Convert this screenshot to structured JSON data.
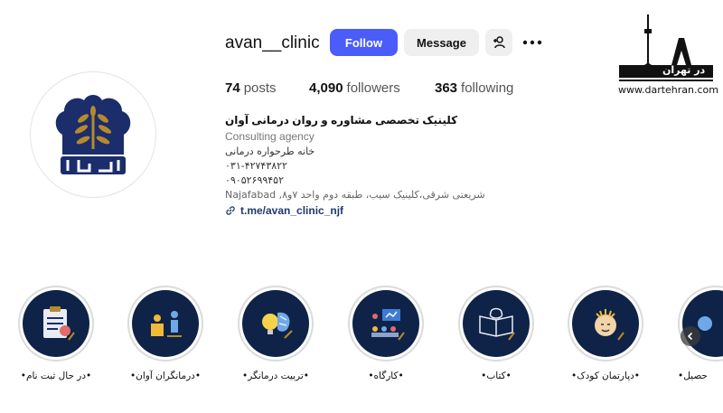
{
  "profile": {
    "username": "avan__clinic",
    "buttons": {
      "follow": "Follow",
      "message": "Message"
    },
    "stats": {
      "posts_count": "74",
      "posts_label": "posts",
      "followers_count": "4,090",
      "followers_label": "followers",
      "following_count": "363",
      "following_label": "following"
    },
    "bio": {
      "name": "کلینیک تخصصی مشاوره و روان درمانی آوان",
      "category": "Consulting agency",
      "line1": "خانه طرحواره درمانی",
      "phone1": "۰۳۱-۴۲۷۴۳۸۲۲",
      "phone2": "۰۹۰۵۲۶۹۹۴۵۲",
      "address": "Najafabad ,شریعتی شرقی،کلینیک سیب، طبقه دوم واحد ۷و۸",
      "link": "t.me/avan_clinic_njf"
    }
  },
  "watermark": {
    "logo_text": "در تهران",
    "url": "www.dartehran.com"
  },
  "highlights": [
    {
      "label": "•در حال ثبت نام•",
      "icon": "registration-clipboard-icon"
    },
    {
      "label": "•درمانگران آوان•",
      "icon": "therapists-icon"
    },
    {
      "label": "•تربیت درمانگر•",
      "icon": "brain-lightbulb-icon"
    },
    {
      "label": "•کارگاه•",
      "icon": "workshop-presentation-icon"
    },
    {
      "label": "•کتاب•",
      "icon": "book-icon"
    },
    {
      "label": "•دپارتمان کودک•",
      "icon": "child-head-icon"
    },
    {
      "label": "حصیل•",
      "icon": "partial-highlight-icon"
    }
  ],
  "colors": {
    "follow_button": "#4a5df9",
    "highlight_bg": "#0e2347",
    "logo_navy": "#1b2d6b",
    "logo_gold": "#b68a2c"
  }
}
